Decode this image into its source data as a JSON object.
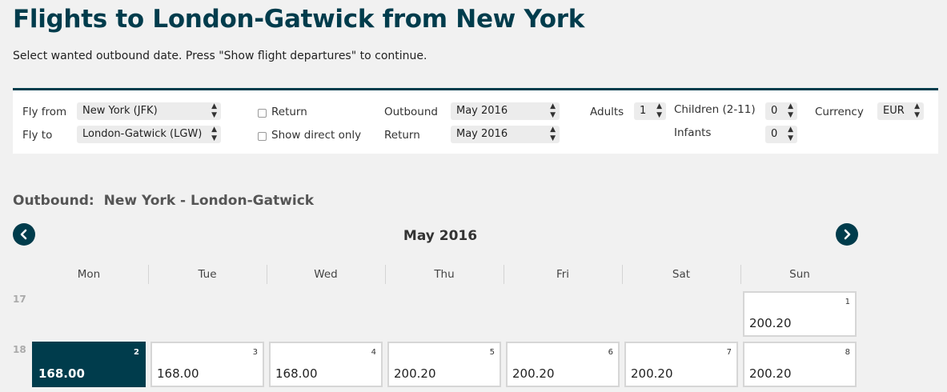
{
  "page": {
    "title": "Flights to London-Gatwick from New York",
    "subtitle": "Select wanted outbound date. Press \"Show flight departures\" to continue."
  },
  "search": {
    "fly_from_label": "Fly from",
    "fly_from_value": "New York (JFK)",
    "fly_to_label": "Fly to",
    "fly_to_value": "London-Gatwick (LGW)",
    "return_label": "Return",
    "return_checked": false,
    "direct_label": "Show direct only",
    "direct_checked": false,
    "outbound_label": "Outbound",
    "outbound_value": "May 2016",
    "return_month_label": "Return",
    "return_month_value": "May 2016",
    "adults_label": "Adults",
    "adults_value": "1",
    "children_label": "Children (2-11)",
    "children_value": "0",
    "infants_label": "Infants",
    "infants_value": "0",
    "currency_label": "Currency",
    "currency_value": "EUR"
  },
  "calendar": {
    "heading_label": "Outbound:",
    "heading_route": "New York - London-Gatwick",
    "month": "May 2016",
    "prev_icon": "chevron-left-icon",
    "next_icon": "chevron-right-icon",
    "weekdays": [
      "Mon",
      "Tue",
      "Wed",
      "Thu",
      "Fri",
      "Sat",
      "Sun"
    ],
    "weeks": [
      {
        "week": "17",
        "days": [
          {
            "day": "1",
            "price": "200.20",
            "selected": false
          }
        ]
      },
      {
        "week": "18",
        "days": [
          {
            "day": "2",
            "price": "168.00",
            "selected": true
          },
          {
            "day": "3",
            "price": "168.00",
            "selected": false
          },
          {
            "day": "4",
            "price": "168.00",
            "selected": false
          },
          {
            "day": "5",
            "price": "200.20",
            "selected": false
          },
          {
            "day": "6",
            "price": "200.20",
            "selected": false
          },
          {
            "day": "7",
            "price": "200.20",
            "selected": false
          },
          {
            "day": "8",
            "price": "200.20",
            "selected": false
          }
        ]
      }
    ]
  },
  "colors": {
    "brand": "#003c4c",
    "background": "#f1f1f1"
  }
}
